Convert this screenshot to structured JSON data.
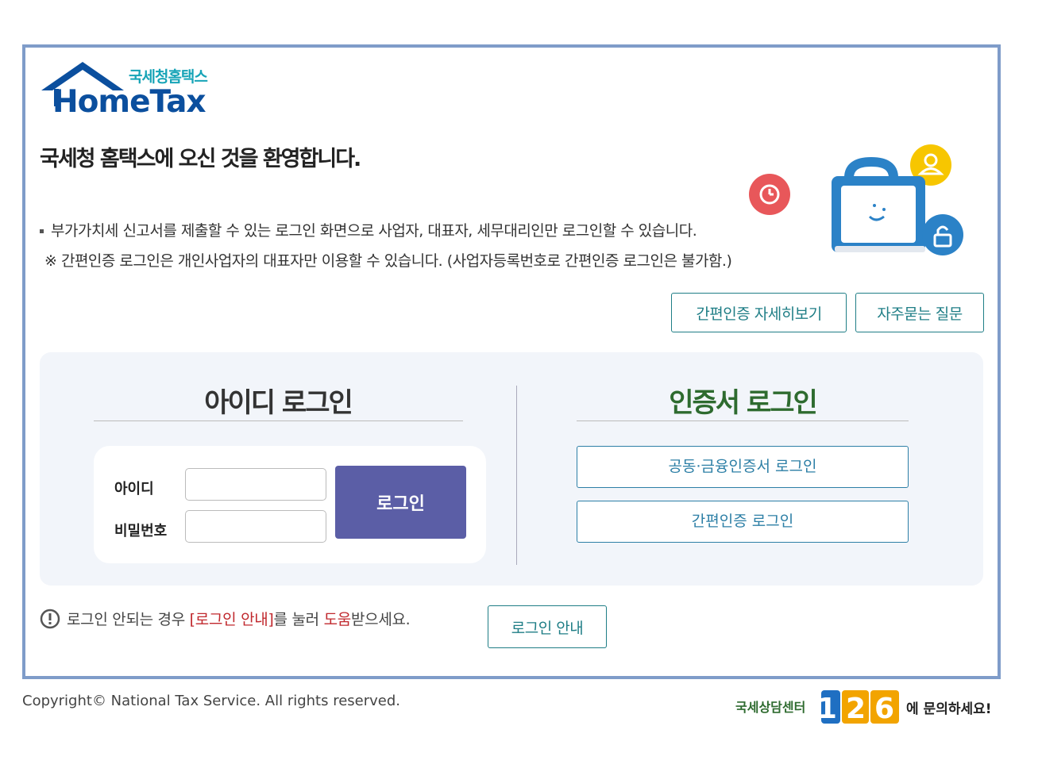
{
  "logo": {
    "subtitle": "국세청홈택스",
    "name": "HomeTax"
  },
  "welcome": "국세청 홈택스에 오신 것을 환영합니다.",
  "notices": [
    "부가가치세 신고서를 제출할 수 있는 로그인 화면으로 사업자, 대표자, 세무대리인만 로그인할 수 있습니다.",
    "※ 간편인증 로그인은 개인사업자의 대표자만 이용할 수 있습니다. (사업자등록번호로 간편인증 로그인은 불가함.)"
  ],
  "top_buttons": {
    "simple_auth_detail": "간편인증 자세히보기",
    "faq": "자주묻는 질문"
  },
  "id_login": {
    "title": "아이디 로그인",
    "id_label": "아이디",
    "id_value": "",
    "password_label": "비밀번호",
    "password_value": "",
    "login_button": "로그인"
  },
  "cert_login": {
    "title": "인증서 로그인",
    "joint_cert_button": "공동·금융인증서 로그인",
    "simple_auth_button": "간편인증 로그인"
  },
  "help": {
    "text_before": "로그인 안되는 경우 ",
    "link_text": "[로그인 안내]",
    "text_middle": "를 눌러 ",
    "highlight": "도움",
    "text_after": "받으세요.",
    "guide_button": "로그인 안내"
  },
  "footer": {
    "copyright": "Copyright© National Tax Service. All rights reserved.",
    "callcenter_prefix": "국세상담센터",
    "callcenter_number": "126",
    "callcenter_suffix": "에 문의하세요!"
  },
  "colors": {
    "frame_border": "#7f9cc9",
    "logo_blue": "#0b4f9e",
    "logo_teal": "#17a4b7",
    "id_title": "#333333",
    "cert_title": "#2e6b2f",
    "login_button": "#5b5ea6",
    "outline_button": "#1f7e86",
    "cert_button": "#2d7fa6",
    "highlight_red": "#c0282d",
    "panel_bg": "#f2f5fa"
  }
}
